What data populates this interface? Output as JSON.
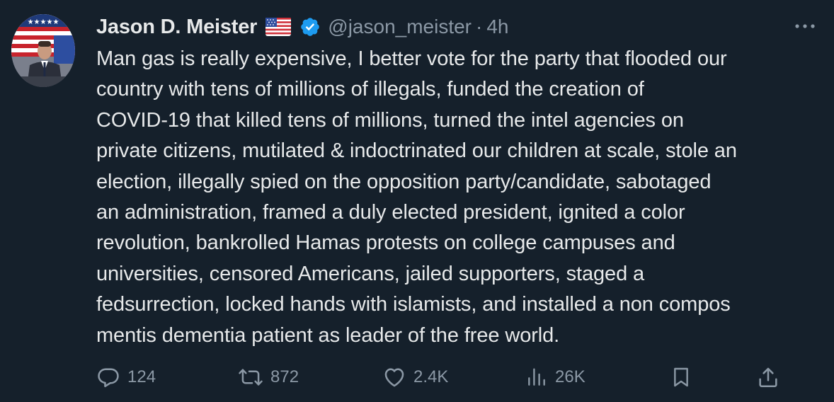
{
  "author": {
    "name": "Jason D. Meister",
    "flag": "🇺🇸",
    "handle": "@jason_meister",
    "separator": "·",
    "time": "4h"
  },
  "tweet_lines": [
    "Man gas is really expensive, I better vote for the party that flooded our",
    "country with tens of millions of illegals, funded the creation of",
    "COVID-19 that killed tens of millions, turned the intel agencies on",
    "private citizens, mutilated & indoctrinated our children at scale, stole an",
    "election, illegally spied on the opposition party/candidate, sabotaged",
    "an administration, framed a duly elected president, ignited a color",
    "revolution, bankrolled Hamas protests on college campuses and",
    "universities, censored Americans, jailed supporters, staged a",
    "fedsurrection, locked hands with islamists, and installed a non compos",
    "mentis dementia patient as leader of the free world."
  ],
  "actions": {
    "replies": "124",
    "reposts": "872",
    "likes": "2.4K",
    "views": "26K"
  },
  "icons": {
    "more": "more-dots-icon",
    "verified": "verified-badge-icon",
    "reply": "reply-icon",
    "repost": "repost-icon",
    "like": "heart-icon",
    "views": "views-icon",
    "bookmark": "bookmark-icon",
    "share": "share-icon"
  },
  "colors": {
    "background": "#15202b",
    "text": "#e7e9ea",
    "secondary": "#8b98a5",
    "verified": "#1d9bf0"
  }
}
